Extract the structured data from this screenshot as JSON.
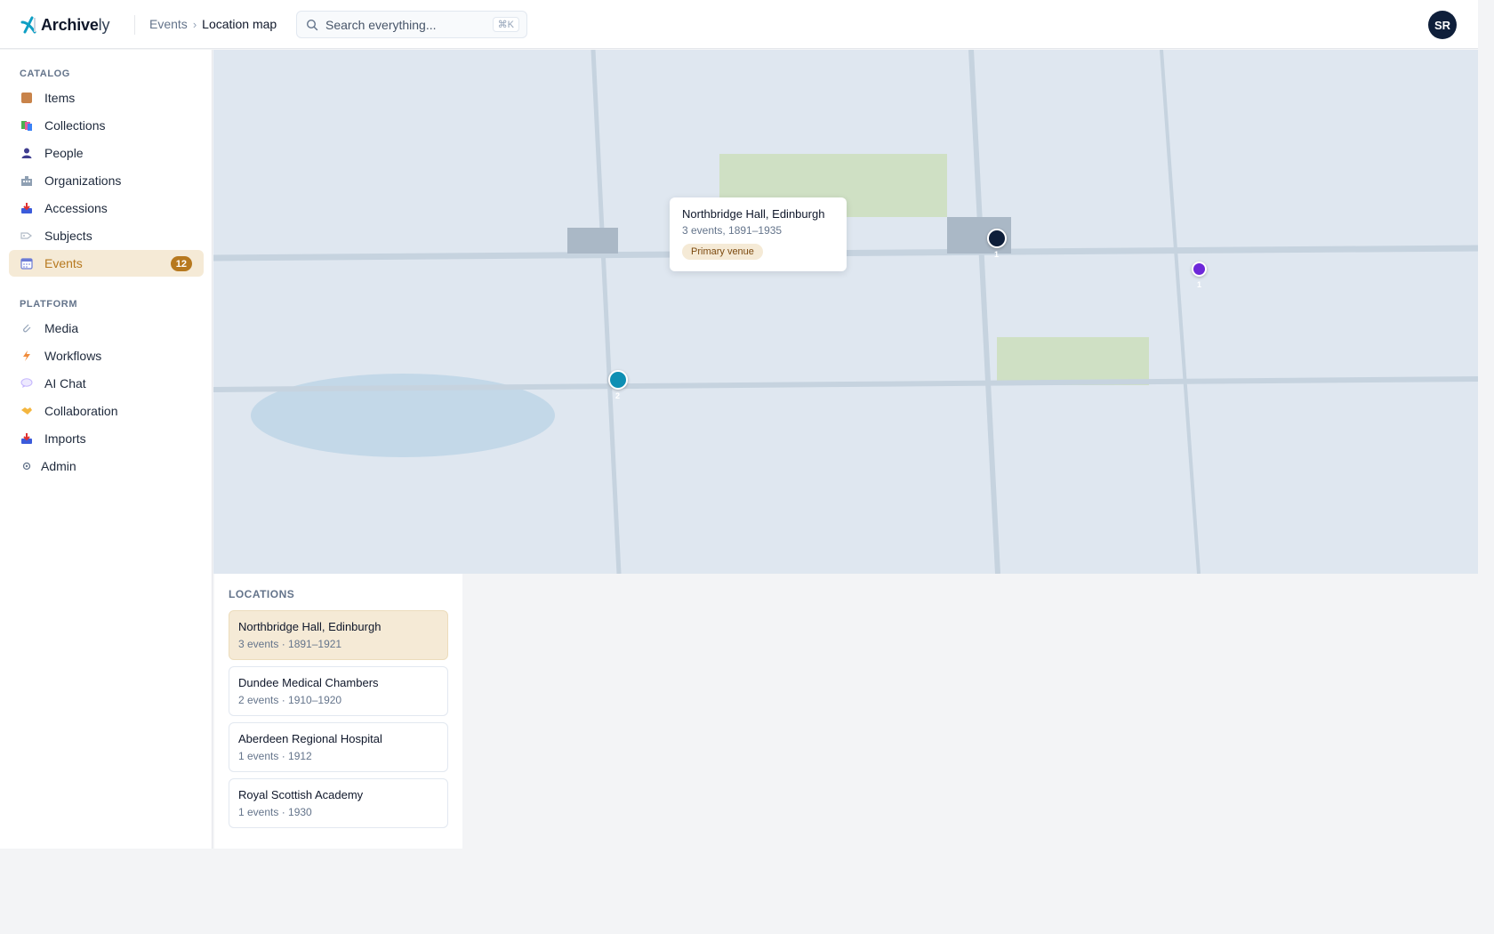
{
  "app": {
    "logo_bold": "Archive",
    "logo_light": "ly"
  },
  "breadcrumb": {
    "parent": "Events",
    "separator": "›",
    "current": "Location map"
  },
  "search": {
    "placeholder": "Search everything...",
    "shortcut": "⌘K"
  },
  "user": {
    "initials": "SR"
  },
  "sidebar": {
    "sections": [
      {
        "label": "CATALOG",
        "items": [
          {
            "label": "Items",
            "icon": "box-icon"
          },
          {
            "label": "Collections",
            "icon": "collections-icon"
          },
          {
            "label": "People",
            "icon": "person-icon"
          },
          {
            "label": "Organizations",
            "icon": "building-icon"
          },
          {
            "label": "Accessions",
            "icon": "inbox-icon"
          },
          {
            "label": "Subjects",
            "icon": "tag-icon"
          },
          {
            "label": "Events",
            "icon": "calendar-icon",
            "badge": "12",
            "active": true
          }
        ]
      },
      {
        "label": "PLATFORM",
        "items": [
          {
            "label": "Media",
            "icon": "paperclip-icon"
          },
          {
            "label": "Workflows",
            "icon": "lightning-icon"
          },
          {
            "label": "AI Chat",
            "icon": "chat-bubble-icon"
          },
          {
            "label": "Collaboration",
            "icon": "handshake-icon"
          },
          {
            "label": "Imports",
            "icon": "import-tray-icon"
          },
          {
            "label": "Admin",
            "icon": "gear-icon"
          }
        ]
      }
    ]
  },
  "map": {
    "markers": [
      {
        "name": "Northbridge Hall, Edinburgh",
        "count": "1",
        "color": "#0f1f3a"
      },
      {
        "name": "Dundee Medical Chambers",
        "count": "2",
        "color": "#0e8fb3"
      },
      {
        "name": "Aberdeen Regional Hospital",
        "count": "1",
        "color": "#6d28d9"
      }
    ],
    "tooltip": {
      "title": "Northbridge Hall, Edinburgh",
      "subtitle": "3 events, 1891–1935",
      "tag": "Primary venue"
    }
  },
  "locations": {
    "label": "LOCATIONS",
    "items": [
      {
        "name": "Northbridge Hall, Edinburgh",
        "meta": "3 events · 1891–1921",
        "active": true
      },
      {
        "name": "Dundee Medical Chambers",
        "meta": "2 events · 1910–1920"
      },
      {
        "name": "Aberdeen Regional Hospital",
        "meta": "1 events · 1912"
      },
      {
        "name": "Royal Scottish Academy",
        "meta": "1 events · 1930"
      }
    ]
  },
  "colors": {
    "accent": "#b7791f",
    "accent_bg": "#f5ead6",
    "map_bg": "#dfe7f0",
    "park": "#cfe0c4",
    "water": "#c3d8e8",
    "road": "#c6d3df",
    "building": "#aab8c6"
  }
}
